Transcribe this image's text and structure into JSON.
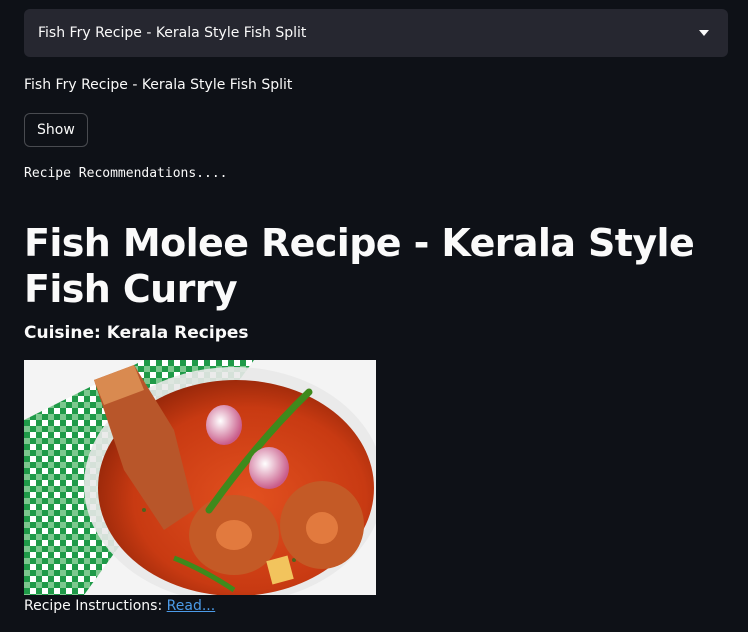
{
  "recipe_select": {
    "selected_value": "Fish Fry Recipe - Kerala Style Fish Split",
    "icon": "chevron-down-icon"
  },
  "selected_text": "Fish Fry Recipe - Kerala Style Fish Split",
  "show_button_label": "Show",
  "recommendations_text": "Recipe Recommendations....",
  "recipe": {
    "title": "Fish Molee Recipe - Kerala Style Fish Curry",
    "cuisine": "Cuisine: Kerala Recipes",
    "instructions_label": "Recipe Instructions:",
    "instructions_link": "Read..."
  },
  "colors": {
    "background": "#0e1117",
    "select_background": "#262730",
    "link": "#4c9be8",
    "text": "#fafafa"
  }
}
